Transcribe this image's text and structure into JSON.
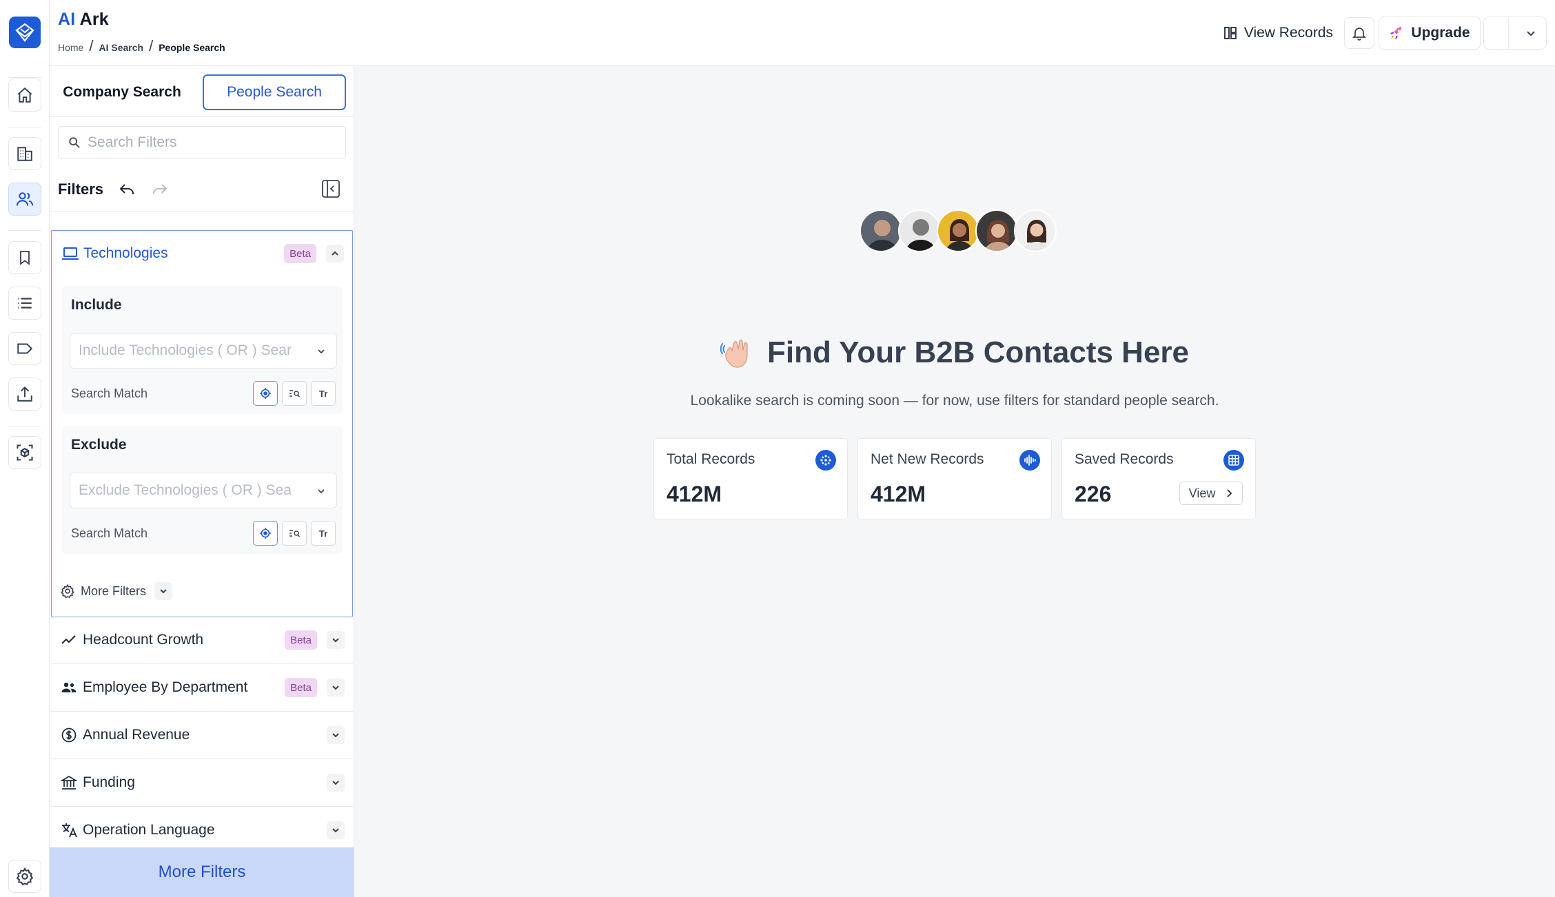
{
  "app": {
    "brand_ai": "AI",
    "brand_name": "Ark",
    "accent_color": "#1e5bd6"
  },
  "breadcrumb": [
    "Home",
    "AI Search",
    "People Search"
  ],
  "header": {
    "view_records_label": "View Records",
    "upgrade_label": "Upgrade",
    "notifications_icon": "bell-icon"
  },
  "rail": {
    "items": [
      {
        "icon": "home-icon",
        "active": false
      },
      {
        "icon": "building-icon",
        "active": false
      },
      {
        "icon": "people-icon",
        "active": true
      },
      {
        "icon": "bookmark-icon",
        "active": false
      },
      {
        "icon": "list-icon",
        "active": false
      },
      {
        "icon": "tag-icon",
        "active": false
      },
      {
        "icon": "upload-icon",
        "active": false
      },
      {
        "icon": "cube-icon",
        "active": false
      },
      {
        "icon": "gear-icon",
        "active": false
      }
    ]
  },
  "panel": {
    "tabs": {
      "company": "Company Search",
      "people": "People Search",
      "selected": "People Search"
    },
    "search_placeholder": "Search Filters",
    "filters_title": "Filters",
    "technologies": {
      "label": "Technologies",
      "badge": "Beta",
      "include": {
        "title": "Include",
        "placeholder": "Include Technologies ( OR ) Sear",
        "match_label": "Search Match"
      },
      "exclude": {
        "title": "Exclude",
        "placeholder": "Exclude Technologies ( OR ) Sea",
        "match_label": "Search Match"
      },
      "more_filters": "More Filters",
      "match_text_button": "Tr"
    },
    "sections": [
      {
        "label": "Headcount Growth",
        "badge": "Beta",
        "icon": "trend-icon"
      },
      {
        "label": "Employee By Department",
        "badge": "Beta",
        "icon": "group-icon"
      },
      {
        "label": "Annual Revenue",
        "badge": "",
        "icon": "dollar-icon"
      },
      {
        "label": "Funding",
        "badge": "",
        "icon": "bank-icon"
      },
      {
        "label": "Operation Language",
        "badge": "",
        "icon": "translate-icon"
      }
    ],
    "more_filters_button": "More Filters"
  },
  "main": {
    "heading": "Find Your B2B Contacts Here",
    "heading_icon": "waving-hand-icon",
    "subtext": "Lookalike search is coming soon — for now, use filters for standard people search.",
    "cards": [
      {
        "label": "Total Records",
        "value": "412M",
        "icon": "sparkle-icon"
      },
      {
        "label": "Net New Records",
        "value": "412M",
        "icon": "waveform-icon"
      },
      {
        "label": "Saved Records",
        "value": "226",
        "icon": "grid-icon",
        "action": "View"
      }
    ]
  }
}
